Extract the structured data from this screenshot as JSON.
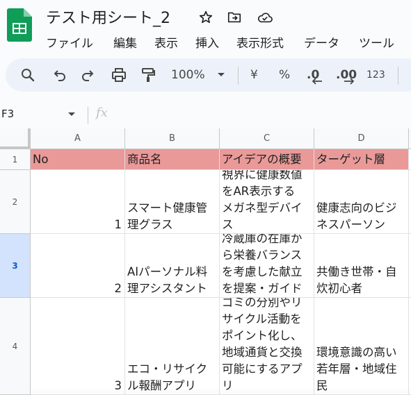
{
  "app": {
    "title": "テスト用シート_2",
    "menu": [
      "ファイル",
      "編集",
      "表示",
      "挿入",
      "表示形式",
      "データ",
      "ツール"
    ]
  },
  "toolbar": {
    "zoom": "100%",
    "currency": "¥",
    "percent": "%",
    "dec_decrease": ".0",
    "dec_increase": ".00",
    "more_formats": "123"
  },
  "formula_bar": {
    "cell_ref": "F3",
    "fx": "fx"
  },
  "sheet": {
    "columns": [
      "A",
      "B",
      "C",
      "D"
    ],
    "rows": [
      "1",
      "2",
      "3",
      "4"
    ],
    "selected_row": "3",
    "header": [
      "No",
      "商品名",
      "アイデアの概要",
      "ターゲット層"
    ],
    "data": [
      {
        "no": "1",
        "name": "スマート健康管\n理グラス",
        "summary": "視界に健康数値\nをAR表示する\nメガネ型デバイ\nス",
        "target": "健康志向のビジ\nネスパーソン"
      },
      {
        "no": "2",
        "name": "AIパーソナル料\n理アシスタント",
        "summary": "冷蔵庫の在庫か\nら栄養バランス\nを考慮した献立\nを提案・ガイド",
        "target": "共働き世帯・自\n炊初心者"
      },
      {
        "no": "3",
        "name": "エコ・リサイク\nル報酬アプリ",
        "summary": "ゴミの分別やリ\nサイクル活動を\nポイント化し、\n地域通貨と交換\n可能にするアプ\nリ",
        "target": "環境意識の高い\n若年層・地域住\n民"
      }
    ]
  },
  "colors": {
    "header_fill": "#ea9999",
    "logo_green": "#0f9d58",
    "selected_row": "#d3e3fd"
  }
}
